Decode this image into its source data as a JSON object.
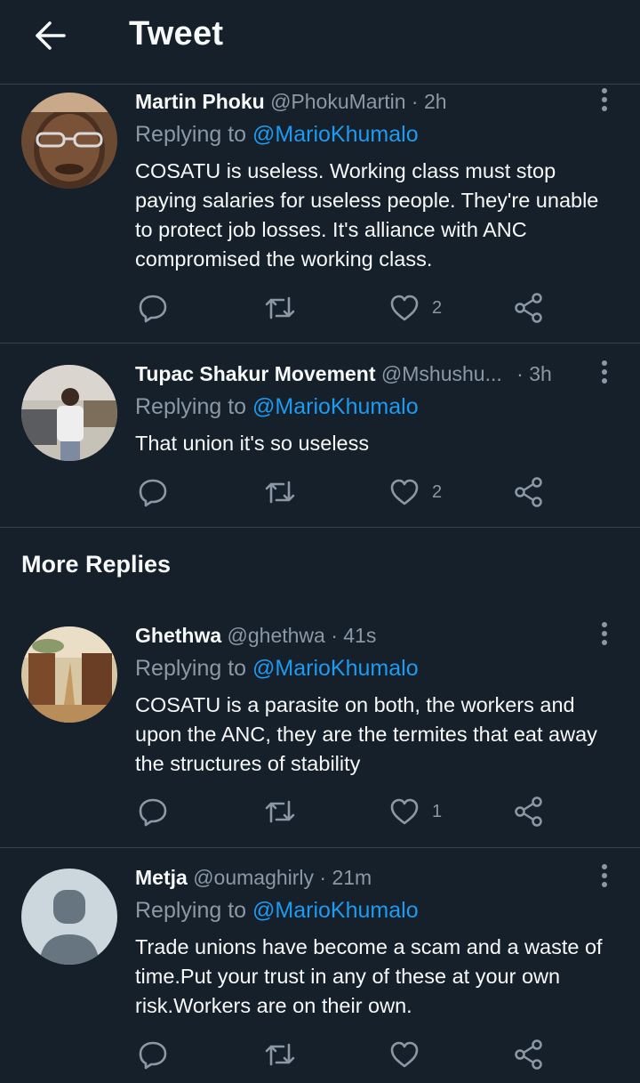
{
  "header": {
    "title": "Tweet"
  },
  "replies": [
    {
      "name": "Martin Phoku",
      "handle": "@PhokuMartin",
      "time": "· 2h",
      "replying_prefix": "Replying to ",
      "replying_to": "@MarioKhumalo",
      "text": "COSATU is useless. Working class must stop paying salaries for useless people. They're unable to protect job losses. It's alliance with ANC compromised the working class.",
      "likes": "2"
    },
    {
      "name": "Tupac Shakur Movement",
      "handle": "@Mshushu...",
      "time": "· 3h",
      "replying_prefix": "Replying to ",
      "replying_to": "@MarioKhumalo",
      "text": "That union it's so useless",
      "likes": "2"
    }
  ],
  "more_replies": {
    "title": "More Replies"
  },
  "more": [
    {
      "name": "Ghethwa",
      "handle": "@ghethwa",
      "time": "· 41s",
      "replying_prefix": "Replying to ",
      "replying_to": "@MarioKhumalo",
      "text": "COSATU is a parasite on both, the workers and upon the ANC, they are the termites that eat away the structures of stability",
      "likes": "1"
    },
    {
      "name": "Metja",
      "handle": "@oumaghirly",
      "time": "· 21m",
      "replying_prefix": "Replying to ",
      "replying_to": "@MarioKhumalo",
      "text": "Trade unions have become a scam and a waste of time.Put your trust in any of these at your own risk.Workers are on their own.",
      "likes": ""
    }
  ],
  "colors": {
    "background": "#15202b",
    "accent": "#1d9bf0",
    "muted": "#8b98a5",
    "divider": "#38444d"
  }
}
